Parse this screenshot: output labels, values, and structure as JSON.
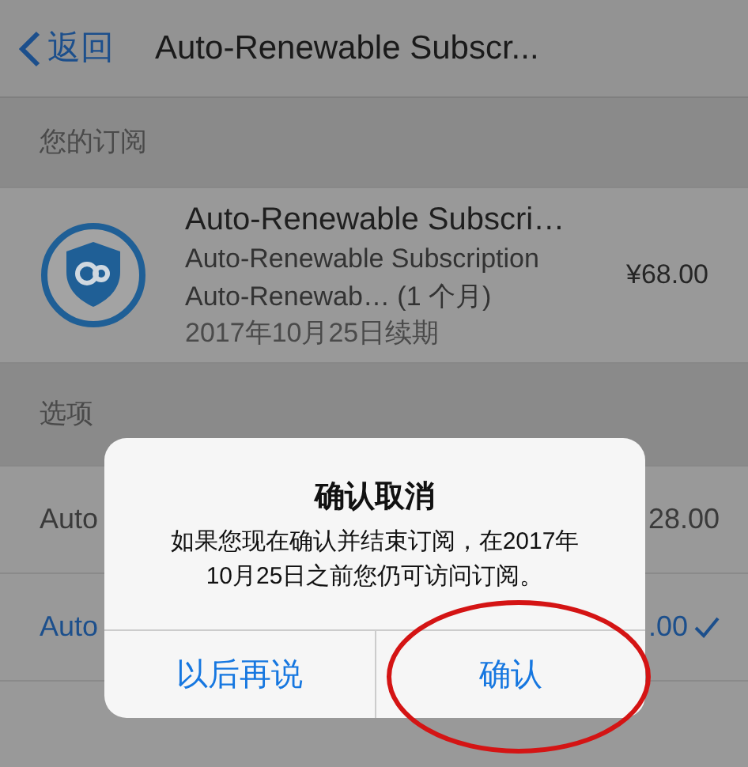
{
  "nav": {
    "back": "返回",
    "title": "Auto-Renewable Subscr..."
  },
  "subscription_section": {
    "header": "您的订阅",
    "item": {
      "name": "Auto-Renewable Subscri…",
      "subtitle": "Auto-Renewable Subscription",
      "plan": "Auto-Renewab… (1 个月)",
      "renewal": "2017年10月25日续期",
      "price": "¥68.00"
    }
  },
  "options_section": {
    "header": "选项",
    "options": [
      {
        "label": "Auto",
        "price": "28.00",
        "selected": false
      },
      {
        "label": "Auto",
        "price": ".00",
        "selected": true
      }
    ]
  },
  "alert": {
    "title": "确认取消",
    "message": "如果您现在确认并结束订阅，在2017年10月25日之前您仍可访问订阅。",
    "buttons": [
      {
        "label": "以后再说",
        "highlighted": false
      },
      {
        "label": "确认",
        "highlighted": true
      }
    ]
  }
}
